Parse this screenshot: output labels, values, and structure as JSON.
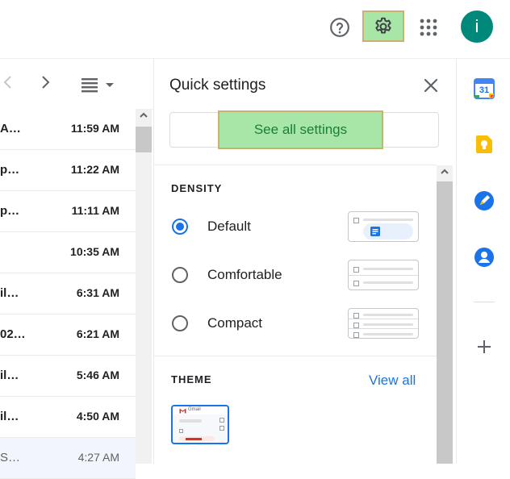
{
  "topbar": {
    "help_icon": "help-circle-icon",
    "settings_icon": "gear-icon",
    "apps_icon": "apps-grid-icon",
    "avatar_letter": "i"
  },
  "mail_list": {
    "rows": [
      {
        "snippet": "A…",
        "time": "11:59 AM",
        "read": false
      },
      {
        "snippet": "p…",
        "time": "11:22 AM",
        "read": false
      },
      {
        "snippet": "p…",
        "time": "11:11 AM",
        "read": false
      },
      {
        "snippet": "",
        "time": "10:35 AM",
        "read": false
      },
      {
        "snippet": "il…",
        "time": "6:31 AM",
        "read": false
      },
      {
        "snippet": "02…",
        "time": "6:21 AM",
        "read": false
      },
      {
        "snippet": "il…",
        "time": "5:46 AM",
        "read": false
      },
      {
        "snippet": "il…",
        "time": "4:50 AM",
        "read": false
      },
      {
        "snippet": "S…",
        "time": "4:27 AM",
        "read": true
      }
    ]
  },
  "quick_settings": {
    "title": "Quick settings",
    "see_all_label": "See all settings",
    "density_heading": "DENSITY",
    "density_options": [
      {
        "label": "Default",
        "selected": true
      },
      {
        "label": "Comfortable",
        "selected": false
      },
      {
        "label": "Compact",
        "selected": false
      }
    ],
    "theme_heading": "THEME",
    "view_all_label": "View all",
    "theme_thumb_text": "Gmail"
  },
  "side_panel": {
    "calendar_date": "31",
    "apps": [
      "calendar-icon",
      "keep-icon",
      "tasks-icon",
      "contacts-icon",
      "add-icon"
    ]
  },
  "colors": {
    "accent": "#1a73e8",
    "highlight": "#a8e6a8",
    "avatar": "#00897b"
  }
}
